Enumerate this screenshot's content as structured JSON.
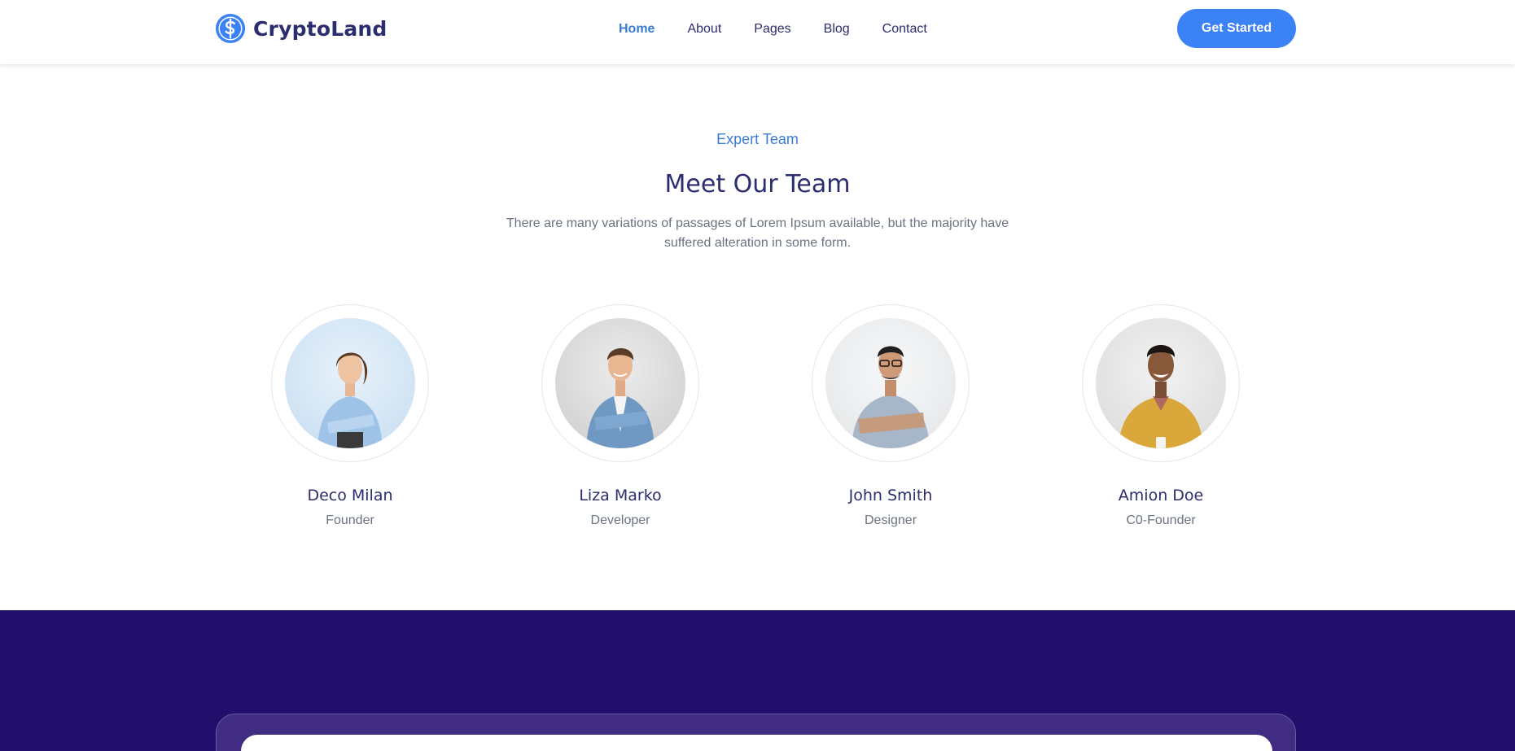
{
  "brand": {
    "name": "CryptoLand",
    "icon": "dollar-coin-icon",
    "accent_color": "#3b82f6",
    "text_color": "#2b2d6f"
  },
  "nav": {
    "items": [
      {
        "label": "Home",
        "active": true
      },
      {
        "label": "About",
        "active": false
      },
      {
        "label": "Pages",
        "active": false
      },
      {
        "label": "Blog",
        "active": false
      },
      {
        "label": "Contact",
        "active": false
      }
    ],
    "cta_label": "Get Started"
  },
  "team": {
    "eyebrow": "Expert Team",
    "title": "Meet Our Team",
    "description": "There are many variations of passages of Lorem Ipsum available, but the majority have suffered alteration in some form.",
    "members": [
      {
        "name": "Deco Milan",
        "role": "Founder",
        "photo": "woman-portrait-photo"
      },
      {
        "name": "Liza Marko",
        "role": "Developer",
        "photo": "man-denim-shirt-portrait-photo"
      },
      {
        "name": "John Smith",
        "role": "Designer",
        "photo": "man-glasses-portrait-photo"
      },
      {
        "name": "Amion Doe",
        "role": "C0-Founder",
        "photo": "man-yellow-sweater-portrait-photo"
      }
    ]
  },
  "footer_band": {
    "background_color": "#220e6b"
  }
}
